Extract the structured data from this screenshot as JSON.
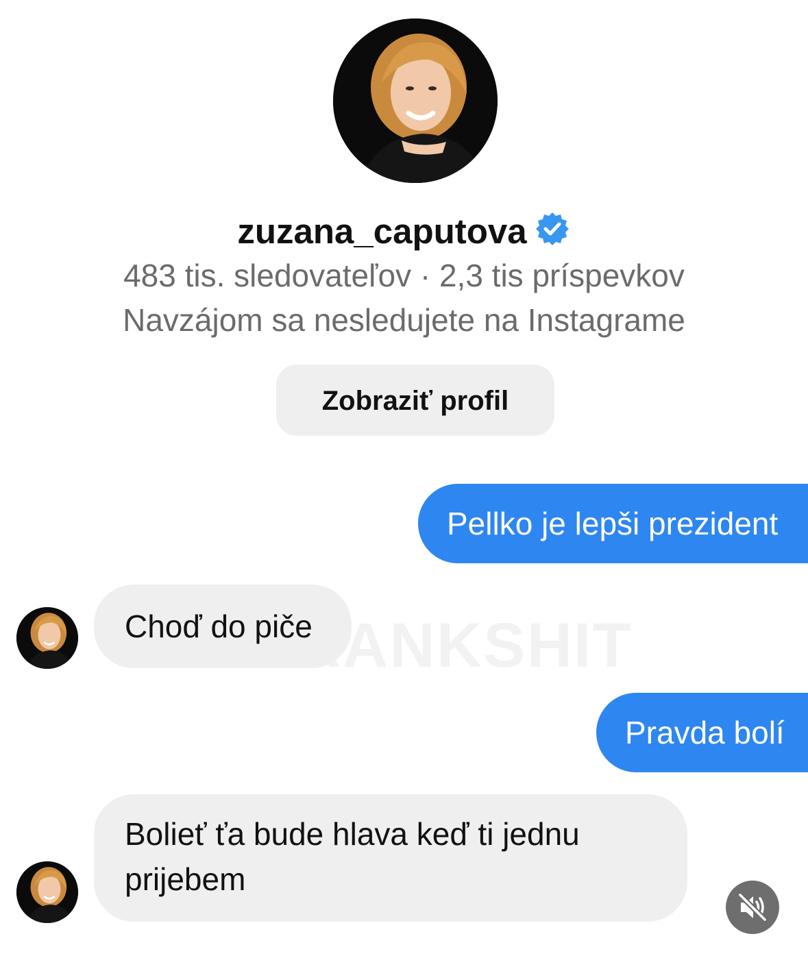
{
  "profile": {
    "username": "zuzana_caputova",
    "verified_icon": "verified-badge-icon",
    "stats": "483 tis. sledovateľov · 2,3 tis príspevkov",
    "mutual_status": "Navzájom sa nesledujete na Instagrame",
    "view_profile_label": "Zobraziť profil"
  },
  "messages": [
    {
      "direction": "outgoing",
      "text": "Pellko je lepši prezident"
    },
    {
      "direction": "incoming",
      "text": "Choď do piče"
    },
    {
      "direction": "outgoing",
      "text": "Pravda bolí"
    },
    {
      "direction": "incoming",
      "text": "Bolieť ťa bude hlava keď ti jednu prijebem"
    }
  ],
  "watermark": "PRANKSHIT",
  "controls": {
    "mute_icon": "speaker-muted-icon"
  },
  "colors": {
    "outgoing_bubble": "#2e86f0",
    "incoming_bubble": "#efefef",
    "verified_badge": "#3897f0",
    "secondary_text": "#6b6b6b"
  }
}
